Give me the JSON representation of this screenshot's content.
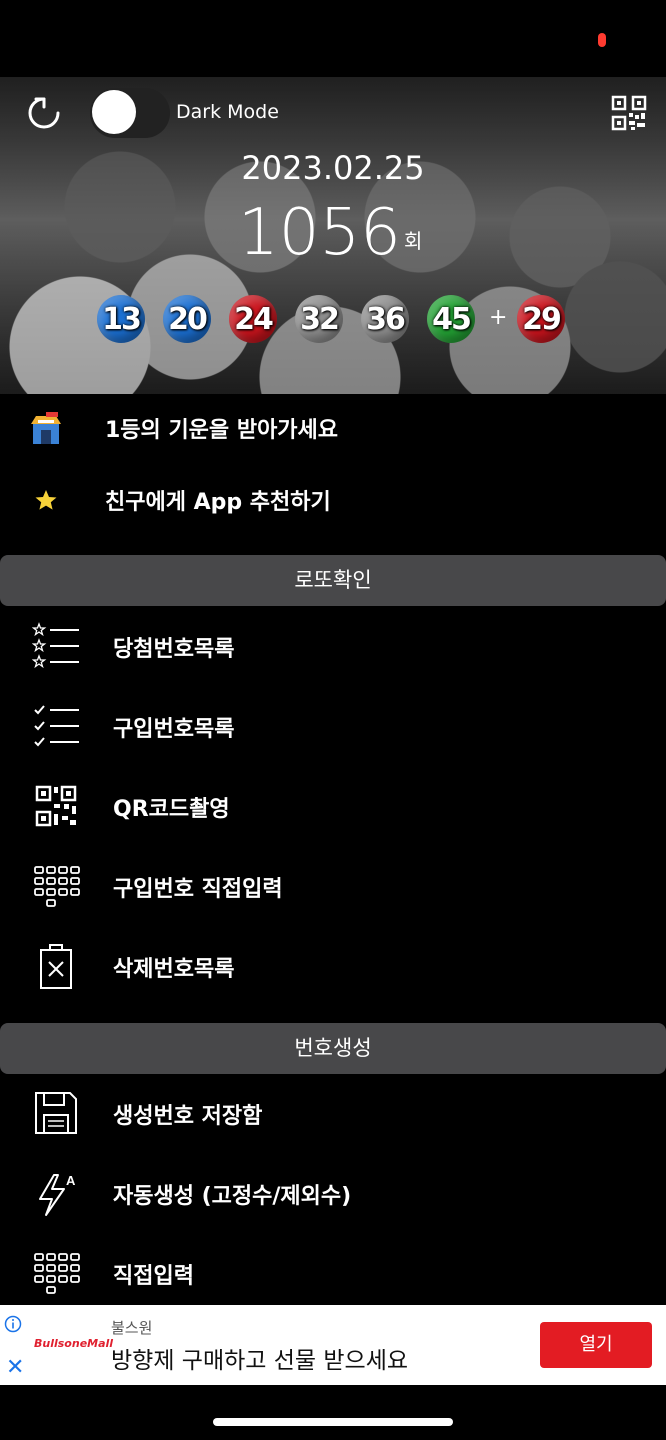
{
  "header": {
    "dark_mode_label": "Dark Mode",
    "dark_mode_on": false,
    "draw_date": "2023.02.25",
    "draw_round": "1056",
    "draw_round_suffix": "회",
    "numbers": [
      {
        "value": "13",
        "color": "#1b6fd1"
      },
      {
        "value": "20",
        "color": "#1b6fd1"
      },
      {
        "value": "24",
        "color": "#c9141d"
      },
      {
        "value": "32",
        "color": "#8d8d8d"
      },
      {
        "value": "36",
        "color": "#8d8d8d"
      },
      {
        "value": "45",
        "color": "#23a134"
      }
    ],
    "plus_sign": "+",
    "bonus": {
      "value": "29",
      "color": "#c9141d"
    }
  },
  "top_menu": [
    {
      "label": "1등의 기운을 받아가세요",
      "icon": "shop-icon"
    },
    {
      "label": "친구에게 App 추천하기",
      "icon": "star-icon"
    }
  ],
  "sections": {
    "check": {
      "title": "로또확인",
      "items": [
        {
          "label": "당첨번호목록",
          "icon": "star-list-icon"
        },
        {
          "label": "구입번호목록",
          "icon": "check-list-icon"
        },
        {
          "label": "QR코드촬영",
          "icon": "qr-code-icon"
        },
        {
          "label": "구입번호 직접입력",
          "icon": "keypad-icon"
        },
        {
          "label": "삭제번호목록",
          "icon": "trash-icon"
        }
      ]
    },
    "generate": {
      "title": "번호생성",
      "items": [
        {
          "label": "생성번호 저장함",
          "icon": "save-icon"
        },
        {
          "label": "자동생성 (고정수/제외수)",
          "icon": "auto-flash-icon"
        },
        {
          "label": "직접입력",
          "icon": "keypad-icon"
        }
      ]
    }
  },
  "ad": {
    "sponsor": "불스원",
    "logo_text": "BullsoneMall",
    "headline": "방향제 구매하고 선물 받으세요",
    "cta": "열기",
    "close_glyph": "✕"
  }
}
